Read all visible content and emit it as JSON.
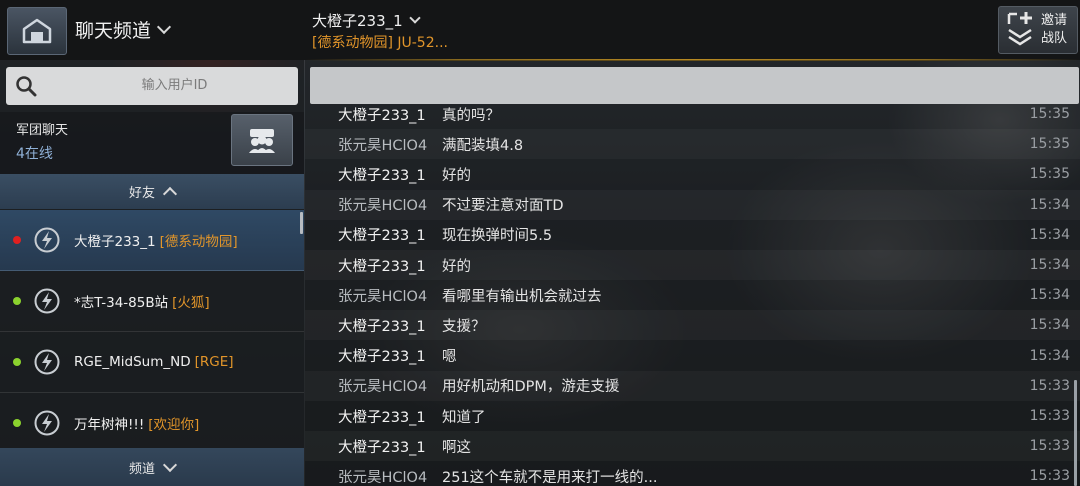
{
  "header": {
    "channel_title": "聊天频道",
    "chat_user": "大橙子233_1",
    "chat_clan": "[德系动物园] JU-52...",
    "invite_line1": "邀请",
    "invite_line2": "战队"
  },
  "search": {
    "placeholder": "输入用户ID"
  },
  "legion": {
    "title": "军团聊天",
    "online": "4在线"
  },
  "friends": {
    "header": "好友",
    "items": [
      {
        "name": "大橙子233_1",
        "tag": "[德系动物园]",
        "status_color": "#e02020",
        "selected": true
      },
      {
        "name": "*志T-34-85B站",
        "tag": "[火狐]",
        "status_color": "#8bd22e",
        "selected": false
      },
      {
        "name": "RGE_MidSum_ND",
        "tag": "[RGE]",
        "status_color": "#8bd22e",
        "selected": false
      },
      {
        "name": "万年树神!!!",
        "tag": "[欢迎你]",
        "status_color": "#8bd22e",
        "selected": false
      }
    ]
  },
  "channel_footer": "频道",
  "colors": {
    "accent_orange": "#e1952a",
    "online_green": "#8bd22e",
    "busy_red": "#e02020"
  },
  "messages": [
    {
      "sender": "大橙子233_1",
      "text": "真的吗？",
      "time": "15:35"
    },
    {
      "sender": "张元昊HClO4",
      "text": "满配装填4.8",
      "time": "15:35"
    },
    {
      "sender": "大橙子233_1",
      "text": "好的",
      "time": "15:35"
    },
    {
      "sender": "张元昊HClO4",
      "text": "不过要注意对面TD",
      "time": "15:34"
    },
    {
      "sender": "大橙子233_1",
      "text": "现在换弹时间5.5",
      "time": "15:34"
    },
    {
      "sender": "大橙子233_1",
      "text": "好的",
      "time": "15:34"
    },
    {
      "sender": "张元昊HClO4",
      "text": "看哪里有输出机会就过去",
      "time": "15:34"
    },
    {
      "sender": "大橙子233_1",
      "text": "支援？",
      "time": "15:34"
    },
    {
      "sender": "大橙子233_1",
      "text": "嗯",
      "time": "15:34"
    },
    {
      "sender": "张元昊HClO4",
      "text": "用好机动和DPM，游走支援",
      "time": "15:33"
    },
    {
      "sender": "大橙子233_1",
      "text": "知道了",
      "time": "15:33"
    },
    {
      "sender": "大橙子233_1",
      "text": "啊这",
      "time": "15:33"
    },
    {
      "sender": "张元昊HClO4",
      "text": "251这个车就不是用来打一线的...",
      "time": "15:33"
    }
  ]
}
